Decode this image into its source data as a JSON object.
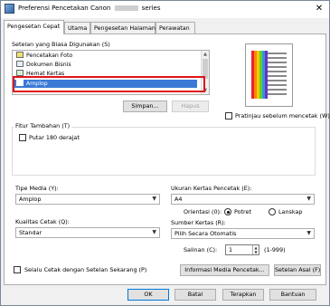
{
  "window": {
    "title_prefix": "Preferensi Pencetakan Canon",
    "title_suffix": "series",
    "close_glyph": "✕"
  },
  "tabs": [
    {
      "label": "Pengesetan Cepat",
      "active": true
    },
    {
      "label": "Utama",
      "active": false
    },
    {
      "label": "Pengesetan Halaman",
      "active": false
    },
    {
      "label": "Perawatan",
      "active": false
    }
  ],
  "common_settings": {
    "label": "Setelan yang Biasa Digunakan (S)",
    "items": [
      {
        "label": "Pencetakan Foto",
        "icon": "photo-print-icon"
      },
      {
        "label": "Dokumen Bisnis",
        "icon": "business-document-icon"
      },
      {
        "label": "Hemat Kertas",
        "icon": "paper-saving-icon"
      },
      {
        "label": "Amplop",
        "icon": "envelope-icon",
        "selected": true
      }
    ],
    "save_button": "Simpan...",
    "delete_button": "Hapus"
  },
  "preview": {
    "label": "Pratinjau sebelum mencetak (W)",
    "checked": false
  },
  "additional_features": {
    "label": "Fitur Tambahan (T)",
    "rotate_label": "Putar 180 derajat",
    "rotate_checked": false
  },
  "media_type": {
    "label": "Tipe Media (Y):",
    "value": "Amplop"
  },
  "paper_size": {
    "label": "Ukuran Kertas Pencetak (E):",
    "value": "A4"
  },
  "orientation": {
    "label": "Orientasi (0):",
    "portrait": "Potret",
    "landscape": "Lanskap",
    "selected": "Potret"
  },
  "print_quality": {
    "label": "Kualitas Cetak (Q):",
    "value": "Standar"
  },
  "paper_source": {
    "label": "Sumber Kertas (R):",
    "value": "Pilih Secara Otomatis"
  },
  "copies": {
    "label": "Salinan (C):",
    "value": "1",
    "range": "(1-999)"
  },
  "always_print_label": "Selalu Cetak dengan Setelan Sekarang (P)",
  "printer_media_button": "Informasi Media Pencetak...",
  "defaults_button": "Setelan Asal (F)",
  "footer": {
    "ok": "OK",
    "cancel": "Batal",
    "apply": "Terapkan",
    "help": "Bantuan"
  },
  "colors": {
    "selection": "#3a79d6",
    "highlight_box": "#e0141b"
  }
}
